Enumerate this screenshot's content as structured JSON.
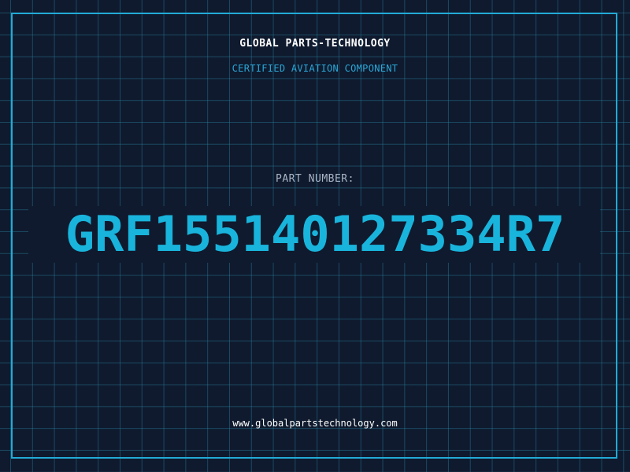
{
  "label": {
    "company": "GLOBAL PARTS-TECHNOLOGY",
    "subtitle": "CERTIFIED AVIATION COMPONENT",
    "part_number_label": "PART NUMBER:",
    "part_number": "GRF155140127334R7",
    "website": "www.globalpartstechnology.com"
  },
  "colors": {
    "background": "#0f1a2e",
    "grid": "#2882a0",
    "frame": "#22aad6",
    "accent": "#19b4dc",
    "title": "#ffffff",
    "label": "#a9b6c6"
  }
}
